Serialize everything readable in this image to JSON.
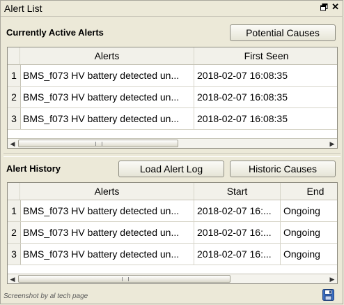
{
  "window": {
    "title": "Alert List"
  },
  "active": {
    "section_label": "Currently Active Alerts",
    "potential_causes_label": "Potential Causes",
    "columns": [
      "Alerts",
      "First Seen"
    ],
    "rows": [
      {
        "num": "1",
        "alert": "BMS_f073 HV battery detected un...",
        "first_seen": "2018-02-07 16:08:35"
      },
      {
        "num": "2",
        "alert": "BMS_f073 HV battery detected un...",
        "first_seen": "2018-02-07 16:08:35"
      },
      {
        "num": "3",
        "alert": "BMS_f073 HV battery detected un...",
        "first_seen": "2018-02-07 16:08:35"
      }
    ]
  },
  "history": {
    "section_label": "Alert History",
    "load_log_label": "Load Alert Log",
    "historic_causes_label": "Historic Causes",
    "columns": [
      "Alerts",
      "Start",
      "End"
    ],
    "rows": [
      {
        "num": "1",
        "alert": "BMS_f073 HV battery detected un...",
        "start": "2018-02-07 16:...",
        "end": "Ongoing"
      },
      {
        "num": "2",
        "alert": "BMS_f073 HV battery detected un...",
        "start": "2018-02-07 16:...",
        "end": "Ongoing"
      },
      {
        "num": "3",
        "alert": "BMS_f073 HV battery detected un...",
        "start": "2018-02-07 16:...",
        "end": "Ongoing"
      }
    ]
  },
  "footer": {
    "watermark": "Screenshot by al tech page"
  },
  "icons": {
    "float": "float-window-icon",
    "close": "close-icon",
    "save": "save-icon",
    "scroll_left": "arrow-left-icon",
    "scroll_right": "arrow-right-icon"
  }
}
